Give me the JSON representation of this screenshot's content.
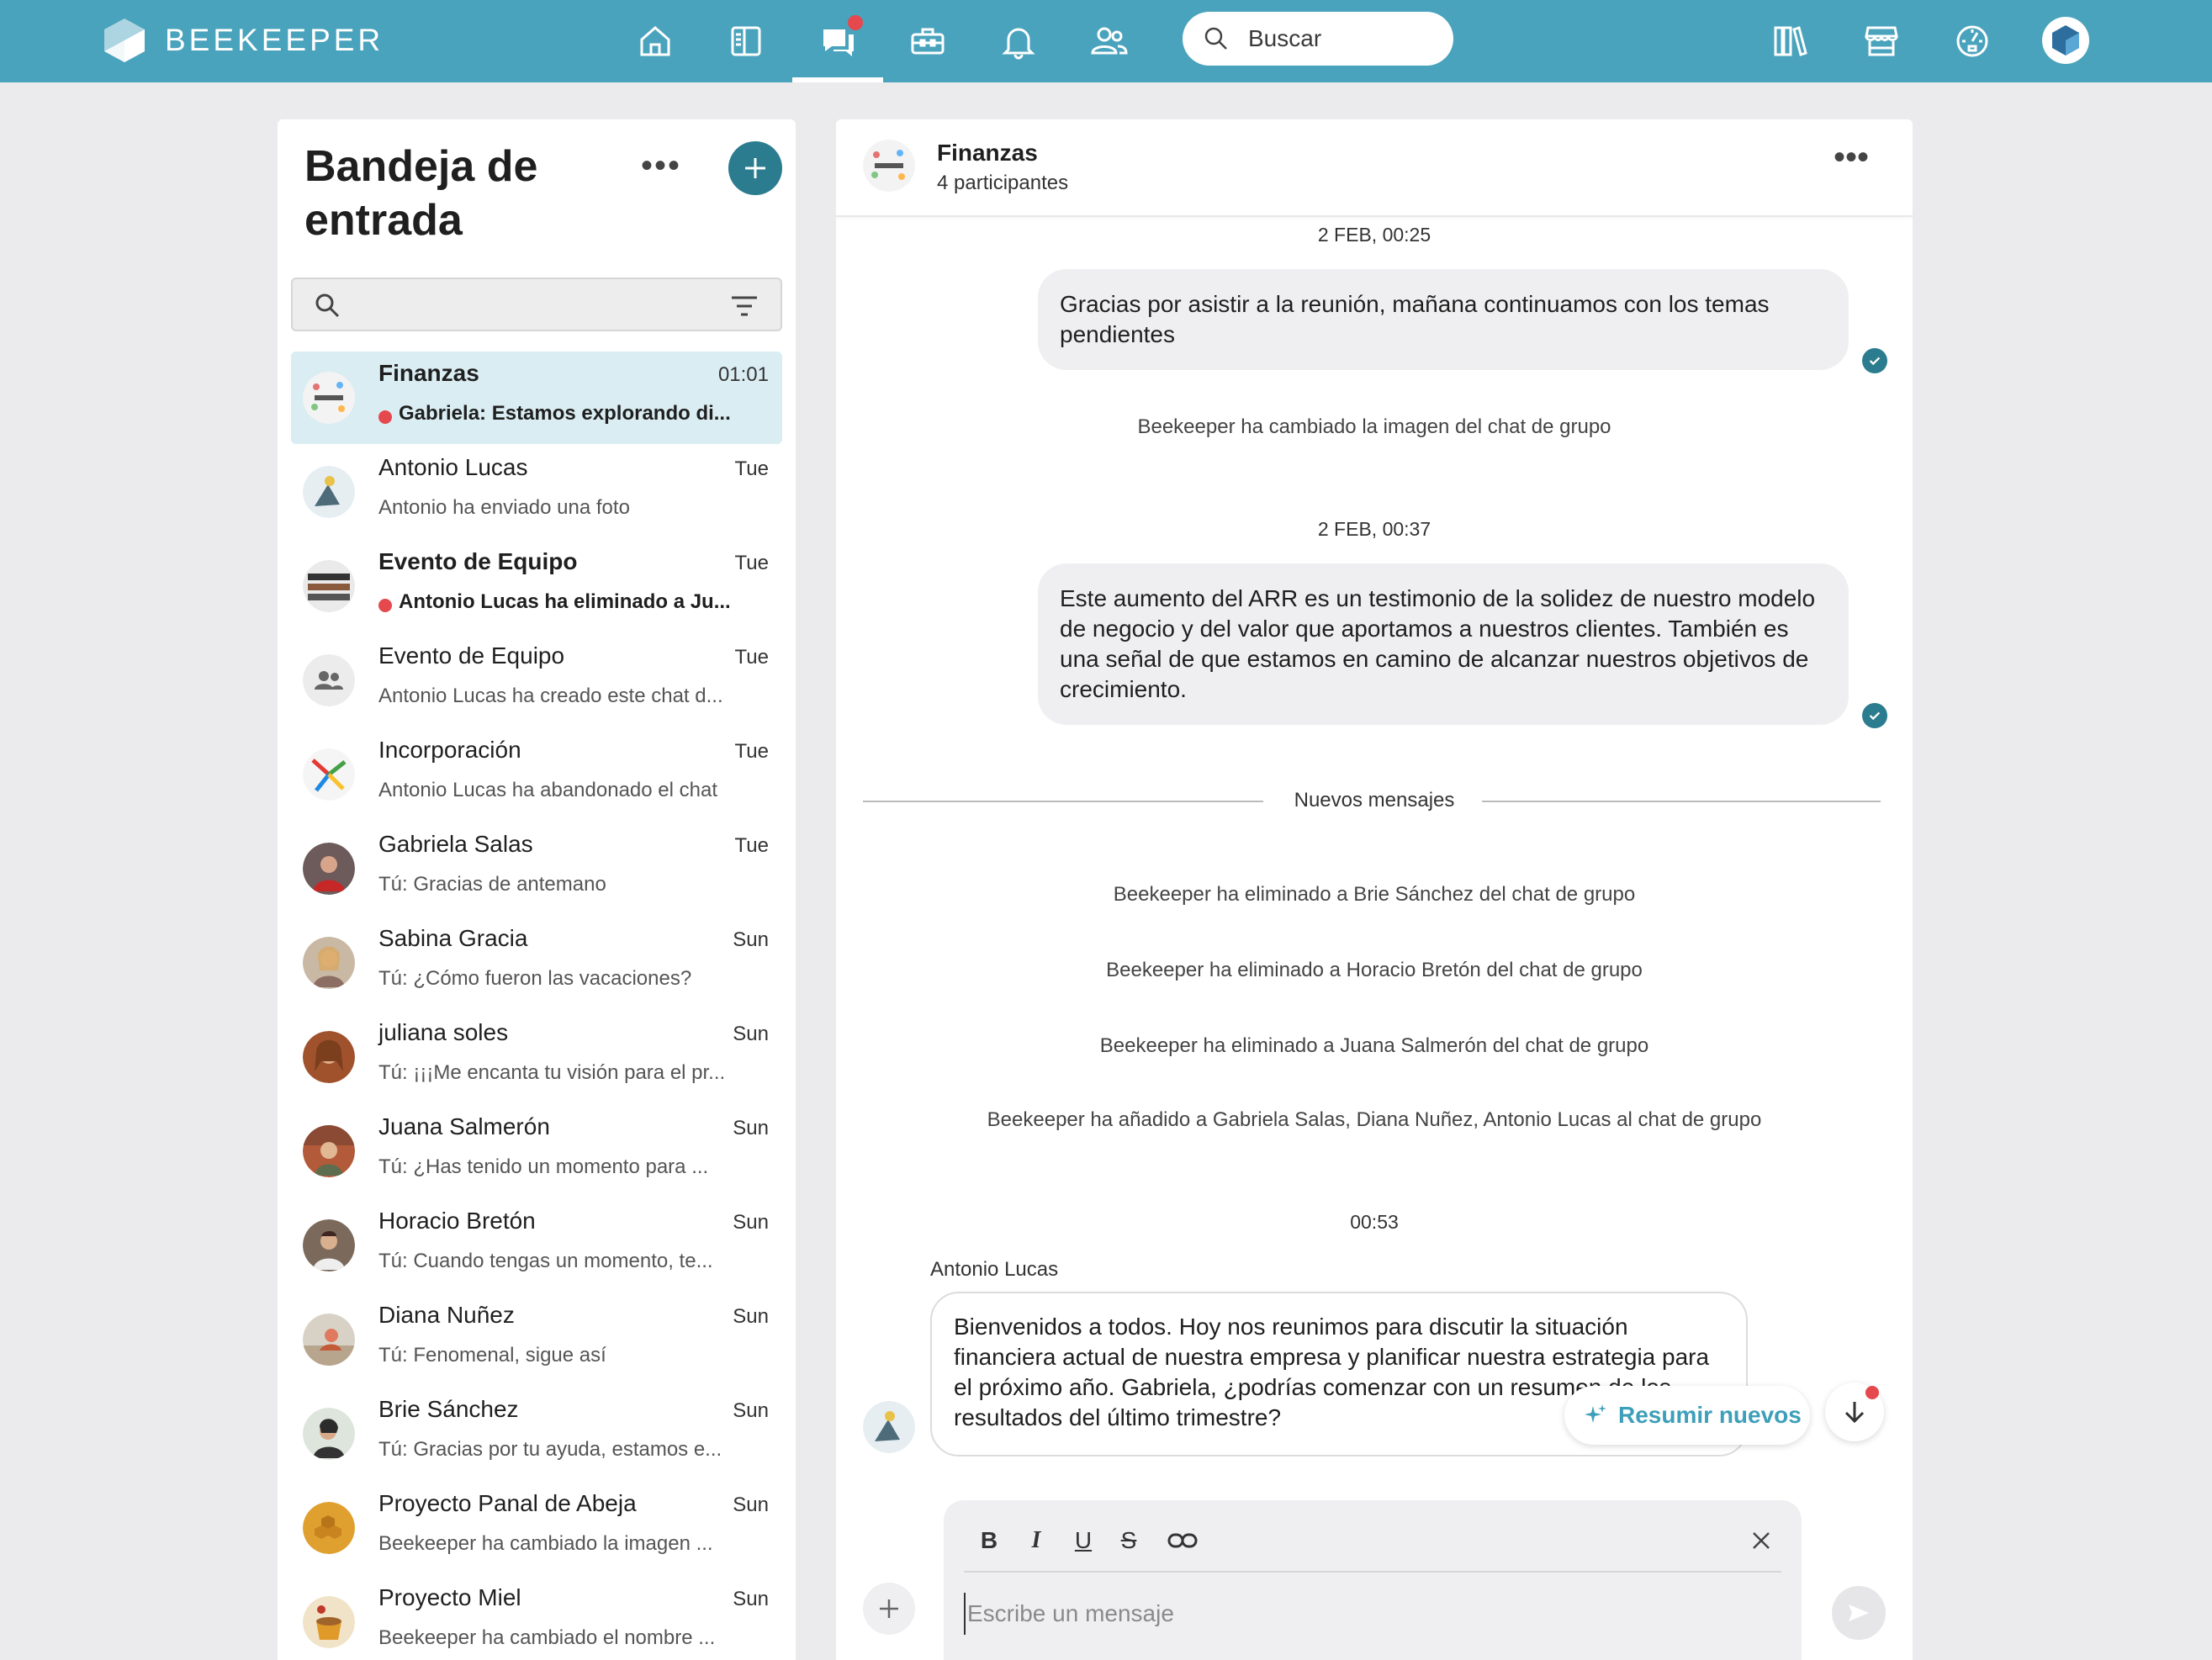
{
  "topbar": {
    "logo_text": "BEEKEEPER",
    "nav_icons": [
      "home-icon",
      "stream-icon",
      "chats-icon",
      "tools-icon",
      "notifications-icon",
      "people-icon"
    ],
    "search_placeholder": "Buscar",
    "right_icons": [
      "library-icon",
      "store-icon",
      "dashboard-icon",
      "profile-avatar"
    ],
    "colors": {
      "bar": "#4aa3bd",
      "notification_dot": "#e5484d"
    }
  },
  "inbox": {
    "title": "Bandeja de entrada",
    "more_label": "•••",
    "add_label": "+",
    "conversations": [
      {
        "name": "Finanzas",
        "time": "01:01",
        "preview": "Gabriela: Estamos explorando di...",
        "unread": true,
        "active": true
      },
      {
        "name": "Antonio Lucas",
        "time": "Tue",
        "preview": "Antonio ha enviado una foto",
        "unread": false
      },
      {
        "name": "Evento de Equipo",
        "time": "Tue",
        "preview": "Antonio Lucas ha eliminado a Ju...",
        "unread": true
      },
      {
        "name": "Evento de Equipo",
        "time": "Tue",
        "preview": "Antonio Lucas ha creado este chat d...",
        "unread": false
      },
      {
        "name": "Incorporación",
        "time": "Tue",
        "preview": "Antonio Lucas ha abandonado el chat",
        "unread": false
      },
      {
        "name": "Gabriela Salas",
        "time": "Tue",
        "preview": "Tú: Gracias de antemano",
        "unread": false
      },
      {
        "name": "Sabina Gracia",
        "time": "Sun",
        "preview": "Tú: ¿Cómo fueron las vacaciones?",
        "unread": false
      },
      {
        "name": "juliana soles",
        "time": "Sun",
        "preview": "Tú: ¡¡¡Me encanta tu visión para el pr...",
        "unread": false
      },
      {
        "name": "Juana Salmerón",
        "time": "Sun",
        "preview": "Tú: ¿Has tenido un momento para ...",
        "unread": false
      },
      {
        "name": "Horacio Bretón",
        "time": "Sun",
        "preview": "Tú: Cuando tengas un momento, te...",
        "unread": false
      },
      {
        "name": "Diana Nuñez",
        "time": "Sun",
        "preview": "Tú: Fenomenal, sigue así",
        "unread": false
      },
      {
        "name": "Brie Sánchez",
        "time": "Sun",
        "preview": "Tú: Gracias por tu ayuda, estamos e...",
        "unread": false
      },
      {
        "name": "Proyecto Panal de Abeja",
        "time": "Sun",
        "preview": "Beekeeper ha cambiado la imagen ...",
        "unread": false
      },
      {
        "name": "Proyecto Miel",
        "time": "Sun",
        "preview": "Beekeeper ha cambiado el nombre ...",
        "unread": false
      }
    ]
  },
  "chat": {
    "title": "Finanzas",
    "participants": "4 participantes",
    "more_label": "•••",
    "messages": {
      "ts1": "2 FEB, 00:25",
      "out1": "Gracias por asistir a la reunión, mañana continuamos con los temas pendientes",
      "sys1": "Beekeeper ha cambiado la imagen del chat de grupo",
      "ts2": "2 FEB, 00:37",
      "out2": "Este aumento del ARR es un testimonio de la solidez de nuestro modelo de negocio y del valor que aportamos a nuestros clientes. También es una señal de que estamos en camino de alcanzar nuestros objetivos de crecimiento.",
      "divider": "Nuevos mensajes",
      "sys2": "Beekeeper ha eliminado a Brie Sánchez del chat de grupo",
      "sys3": "Beekeeper ha eliminado a Horacio Bretón del chat de grupo",
      "sys4": "Beekeeper ha eliminado a Juana Salmerón del chat de grupo",
      "sys5": "Beekeeper ha añadido a Gabriela Salas, Diana Nuñez, Antonio Lucas al chat de grupo",
      "ts3": "00:53",
      "sender": "Antonio Lucas",
      "in1": "Bienvenidos a todos. Hoy nos reunimos para discutir la situación financiera actual de nuestra empresa y planificar nuestra estrategia para el próximo año. Gabriela, ¿podrías comenzar con un resumen de los resultados del último trimestre?"
    },
    "summarize_label": "Resumir nuevos",
    "composer": {
      "placeholder": "Escribe un mensaje",
      "format_buttons": {
        "bold": "B",
        "italic": "I",
        "underline": "U",
        "strike": "S"
      }
    },
    "colors": {
      "accent": "#2a7c8e",
      "link": "#3d9fb9"
    }
  }
}
